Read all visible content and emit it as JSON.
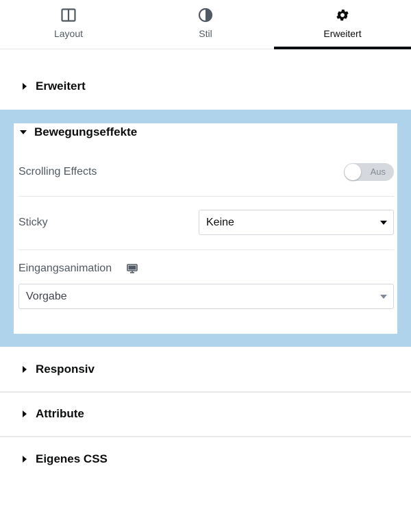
{
  "tabs": [
    {
      "label": "Layout",
      "icon": "layout-columns-icon",
      "active": false
    },
    {
      "label": "Stil",
      "icon": "half-circle-contrast-icon",
      "active": false
    },
    {
      "label": "Erweitert",
      "icon": "gear-icon",
      "active": true
    }
  ],
  "sections": {
    "erweitert": {
      "title": "Erweitert",
      "expanded": false
    },
    "bewegungseffekte": {
      "title": "Bewegungseffekte",
      "expanded": true
    },
    "responsiv": {
      "title": "Responsiv",
      "expanded": false
    },
    "attribute": {
      "title": "Attribute",
      "expanded": false
    },
    "eigenes_css": {
      "title": "Eigenes CSS",
      "expanded": false
    }
  },
  "controls": {
    "scrolling_effects": {
      "label": "Scrolling Effects",
      "toggle_text": "Aus",
      "on": false
    },
    "sticky": {
      "label": "Sticky",
      "value": "Keine"
    },
    "eingangsanimation": {
      "label": "Eingangsanimation",
      "device_icon": "desktop-monitor-icon",
      "value": "Vorgabe"
    }
  },
  "colors": {
    "highlight": "#afd3ea",
    "text": "#0c0d0e",
    "muted_text": "#515962",
    "border": "#d5d8dc"
  }
}
